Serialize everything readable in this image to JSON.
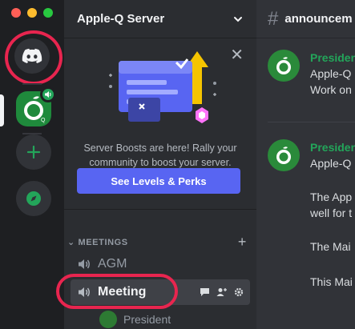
{
  "server": {
    "name": "Apple-Q Server"
  },
  "boost": {
    "text": "Server Boosts are here! Rally your community to boost your server.",
    "button_label": "See Levels & Perks"
  },
  "category": {
    "name": "MEETINGS"
  },
  "channels": [
    {
      "name": "AGM"
    },
    {
      "name": "Meeting"
    }
  ],
  "voice_member": {
    "name": "President"
  },
  "chat": {
    "channel_name": "announcem",
    "messages": [
      {
        "author": "Presiden",
        "lines": [
          "Apple-Q",
          "Work on"
        ]
      },
      {
        "author": "Presiden",
        "lines": [
          "Apple-Q",
          "The App",
          "well for t",
          "The Mai",
          "This Mai"
        ]
      }
    ]
  },
  "colors": {
    "highlight_ring": "#e8254f",
    "brand": "#5865f2",
    "online_green": "#23a55a"
  }
}
